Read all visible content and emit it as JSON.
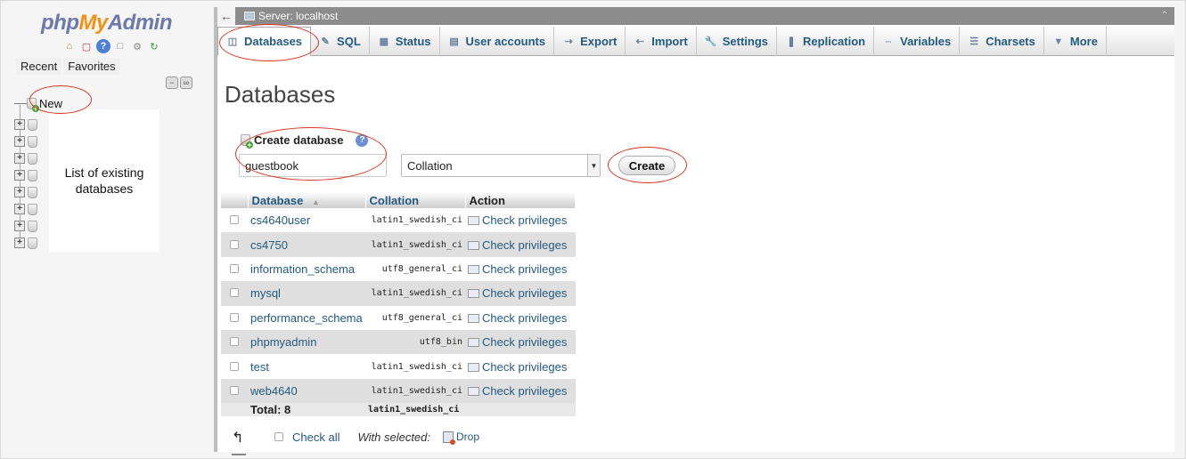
{
  "app": {
    "logo": {
      "part1": "php",
      "part2": "My",
      "part3": "Admin"
    }
  },
  "nav": {
    "tabs": [
      "Recent",
      "Favorites"
    ],
    "new_label": "New",
    "overlay_line1": "List of existing",
    "overlay_line2": "databases",
    "tree_rows": 8
  },
  "serverbar": {
    "label": "Server: localhost"
  },
  "menu": {
    "tabs": [
      {
        "label": "Databases",
        "icon": "database-icon",
        "active": true
      },
      {
        "label": "SQL",
        "icon": "sql-icon"
      },
      {
        "label": "Status",
        "icon": "status-icon"
      },
      {
        "label": "User accounts",
        "icon": "users-icon"
      },
      {
        "label": "Export",
        "icon": "export-icon"
      },
      {
        "label": "Import",
        "icon": "import-icon"
      },
      {
        "label": "Settings",
        "icon": "wrench-icon"
      },
      {
        "label": "Replication",
        "icon": "replication-icon"
      },
      {
        "label": "Variables",
        "icon": "variables-icon"
      },
      {
        "label": "Charsets",
        "icon": "charsets-icon"
      },
      {
        "label": "More",
        "icon": "chevron-down-icon"
      }
    ]
  },
  "main": {
    "title": "Databases",
    "create_label": "Create database",
    "db_name_value": "guestbook",
    "collation_value": "Collation",
    "create_button": "Create"
  },
  "table": {
    "headers": {
      "database": "Database",
      "collation": "Collation",
      "action": "Action"
    },
    "rows": [
      {
        "name": "cs4640user",
        "collation": "latin1_swedish_ci",
        "action": "Check privileges"
      },
      {
        "name": "cs4750",
        "collation": "latin1_swedish_ci",
        "action": "Check privileges"
      },
      {
        "name": "information_schema",
        "collation": "utf8_general_ci",
        "action": "Check privileges"
      },
      {
        "name": "mysql",
        "collation": "latin1_swedish_ci",
        "action": "Check privileges"
      },
      {
        "name": "performance_schema",
        "collation": "utf8_general_ci",
        "action": "Check privileges"
      },
      {
        "name": "phpmyadmin",
        "collation": "utf8_bin",
        "action": "Check privileges"
      },
      {
        "name": "test",
        "collation": "latin1_swedish_ci",
        "action": "Check privileges"
      },
      {
        "name": "web4640",
        "collation": "latin1_swedish_ci",
        "action": "Check privileges"
      }
    ],
    "total_label": "Total: 8",
    "total_collation": "latin1_swedish_ci"
  },
  "footer": {
    "check_all": "Check all",
    "with_selected": "With selected:",
    "drop": "Drop"
  },
  "colors": {
    "link": "#235a81",
    "annotation": "#d9361f"
  }
}
